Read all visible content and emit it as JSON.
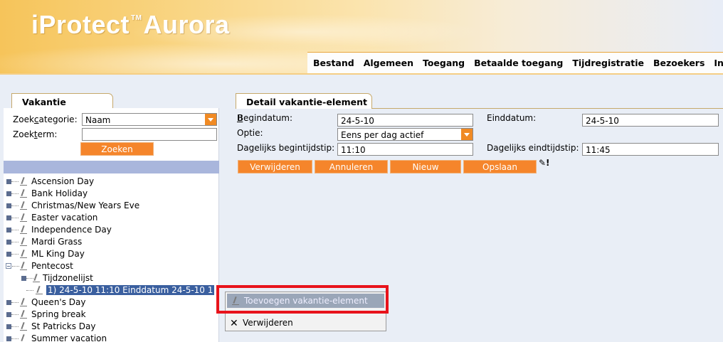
{
  "header": {
    "logo_left": "iProtect",
    "logo_tm": "TM",
    "logo_right": "Aurora",
    "menu": [
      "Bestand",
      "Algemeen",
      "Toegang",
      "Betaalde toegang",
      "Tijdregistratie",
      "Bezoekers",
      "In"
    ]
  },
  "left": {
    "tab_title": "Vakantie",
    "search_category_label_a": "Zoek",
    "search_category_label_u": "c",
    "search_category_label_b": "ategorie:",
    "search_category_value": "Naam",
    "search_term_label_a": "Zoek",
    "search_term_label_u": "t",
    "search_term_label_b": "erm:",
    "search_term_value": "",
    "search_button": "Zoeken",
    "tree": [
      {
        "label": "Ascension Day"
      },
      {
        "label": "Bank Holiday"
      },
      {
        "label": "Christmas/New Years Eve"
      },
      {
        "label": "Easter vacation"
      },
      {
        "label": "Independence Day"
      },
      {
        "label": "Mardi Grass"
      },
      {
        "label": "ML King Day"
      },
      {
        "label": "Pentecost"
      },
      {
        "label": "Tijdzonelijst"
      },
      {
        "label": "1) 24-5-10 11:10 Einddatum 24-5-10 1"
      },
      {
        "label": "Queen's Day"
      },
      {
        "label": "Spring break"
      },
      {
        "label": "St Patricks Day"
      },
      {
        "label": "Summer vacation"
      }
    ]
  },
  "right": {
    "tab_title": "Detail vakantie-element",
    "begin_date_label": "Begindatum:",
    "begin_date_value": "24-5-10",
    "end_date_label": "Einddatum:",
    "end_date_value": "24-5-10",
    "option_label": "Optie:",
    "option_value": "Eens per dag actief",
    "daily_start_label": "Dagelijks begintijdstip:",
    "daily_start_value": "11:10",
    "daily_end_label": "Dagelijks eindtijdstip:",
    "daily_end_value": "11:45",
    "buttons": [
      "Verwijderen",
      "Annuleren",
      "Nieuw",
      "Opslaan"
    ]
  },
  "context_menu": {
    "add_item": "Toevoegen vakantie-element",
    "delete_item": "Verwijderen"
  },
  "colors": {
    "accent_orange": "#f5852b",
    "highlight_red": "#e8131b",
    "selection_blue": "#3a5f9f"
  }
}
